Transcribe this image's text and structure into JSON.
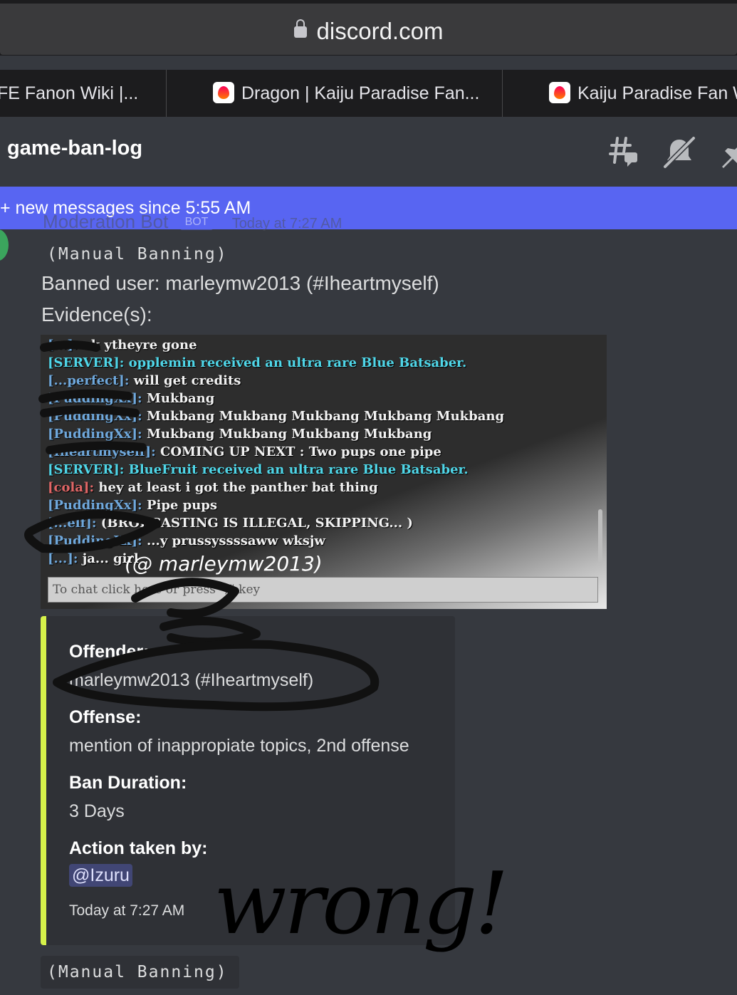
{
  "browser": {
    "url": "discord.com",
    "tabs": [
      {
        "label": "FE Fanon Wiki |..."
      },
      {
        "label": "Dragon | Kaiju Paradise Fan..."
      },
      {
        "label": "Kaiju Paradise Fan W"
      }
    ]
  },
  "header": {
    "channel_name": "game-ban-log",
    "icons": [
      "threads-icon",
      "mute-bell-icon",
      "pin-icon"
    ]
  },
  "new_messages_bar": {
    "label": "+ new messages since 5:55 AM"
  },
  "message": {
    "ghost_author": "Moderation Bot",
    "ghost_badge": "BOT",
    "ghost_time": "Today at 7:27 AM",
    "title_line": "(Manual Banning)",
    "banned_user_line": "Banned user: marleymw2013 (#Iheartmyself)",
    "evidence_label": "Evidence(s):",
    "evidence_chat": [
      {
        "name": "[...]:",
        "text": "ok ytheyre gone",
        "server": false
      },
      {
        "name": "",
        "text": "[SERVER]: opplemin received an ultra rare Blue Batsaber.",
        "server": true
      },
      {
        "name": "[...perfect]:",
        "text": "will get credits",
        "server": false
      },
      {
        "name": "[PuddingXx]:",
        "text": "Mukbang",
        "server": false
      },
      {
        "name": "[PuddingXx]:",
        "text": "Mukbang Mukbang Mukbang Mukbang Mukbang",
        "server": false
      },
      {
        "name": "[PuddingXx]:",
        "text": "Mukbang Mukbang Mukbang Mukbang",
        "server": false
      },
      {
        "name": "[Iheartmyself]:",
        "text": "COMING UP NEXT : Two pups one pipe",
        "server": false
      },
      {
        "name": "",
        "text": "[SERVER]: BlueFruit received an ultra rare Blue Batsaber.",
        "server": true
      },
      {
        "name": "[cola]:",
        "text": "hey at least i got the panther bat thing",
        "server": false
      },
      {
        "name": "[PuddingXx]:",
        "text": "Pipe pups",
        "server": false
      },
      {
        "name": "[...elf]:",
        "text": "(BRODCASTING IS ILLEGAL, SKIPPING... )",
        "server": false
      },
      {
        "name": "[PuddingXx]:",
        "text": "...y prussyssssaww wksjw",
        "server": false
      },
      {
        "name": "[...]:",
        "text": "ja... girl",
        "server": false
      }
    ],
    "evidence_overlay_tag": "(@ marleymw2013)",
    "evidence_chatbox_placeholder": "To chat click here or press \"/\" key",
    "embed": {
      "accent_color": "#d6f24a",
      "fields": [
        {
          "name": "Offender:",
          "value": "marleymw2013 (#Iheartmyself)"
        },
        {
          "name": "Offense:",
          "value": "mention of inappropiate topics, 2nd offense"
        },
        {
          "name": "Ban Duration:",
          "value": "3 Days"
        },
        {
          "name": "Action taken by:",
          "value": "@Izuru"
        }
      ],
      "footer": "Today at 7:27 AM"
    },
    "next_title_line": "(Manual Banning)"
  },
  "annotations": {
    "handwriting": "wrong!"
  },
  "colors": {
    "background": "#36393f",
    "blurple": "#5865f2",
    "embed_bg": "#2f3136"
  }
}
